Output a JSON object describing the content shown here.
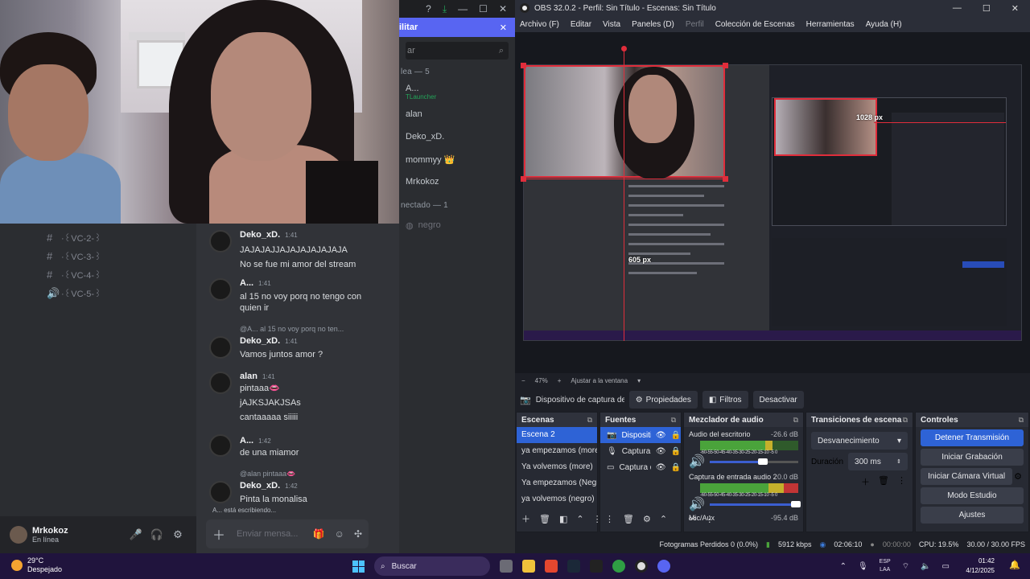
{
  "discord": {
    "banner": {
      "label": "ilitar"
    },
    "member_search": {
      "placeholder": "ar"
    },
    "members": {
      "online_heading": "lea — 5",
      "online": [
        {
          "name": "A...",
          "status": "TLauncher"
        },
        {
          "name": "alan",
          "status": ""
        },
        {
          "name": "Deko_xD.",
          "status": ""
        },
        {
          "name": "mommyy 👑",
          "status": ""
        },
        {
          "name": "Mrkokoz",
          "status": ""
        }
      ],
      "offline_heading": "nectado — 1",
      "offline": [
        {
          "name": "negro"
        }
      ]
    },
    "channels": [
      {
        "icon": "#",
        "name": "·꒰VC-2-꒱"
      },
      {
        "icon": "#",
        "name": "·꒰VC-3-꒱"
      },
      {
        "icon": "#",
        "name": "·꒰VC-4-꒱"
      },
      {
        "icon": "🔊",
        "name": "·꒰VC-5-꒱"
      }
    ],
    "user": {
      "name": "Mrkokoz",
      "status": "En línea"
    },
    "messages": [
      {
        "author": "Deko_xD.",
        "time": "1:41",
        "lines": [
          "JAJAJAJJAJAJAJAJAJAJA",
          "No se fue mi amor del stream"
        ],
        "reply": ""
      },
      {
        "author": "A...",
        "time": "1:41",
        "lines": [
          "al 15 no voy porq no tengo con",
          "quien ir"
        ],
        "reply": ""
      },
      {
        "author": "Deko_xD.",
        "time": "1:41",
        "lines": [
          "Vamos juntos amor ?"
        ],
        "reply": "@A... al 15 no voy porq no ten..."
      },
      {
        "author": "alan",
        "time": "1:41",
        "lines": [
          "pintaaa👄",
          "jAJKSJAKJSAs",
          "cantaaaaa siiiii"
        ],
        "reply": ""
      },
      {
        "author": "A...",
        "time": "1:42",
        "lines": [
          "de una miamor"
        ],
        "reply": ""
      },
      {
        "author": "Deko_xD.",
        "time": "1:42",
        "lines": [
          "Pinta la monalisa"
        ],
        "reply": "@alan pintaaa👄"
      }
    ],
    "typing": "A... está escribiendo...",
    "input_placeholder": "Enviar mensa..."
  },
  "obs": {
    "title": "OBS 32.0.2 - Perfil: Sin Título - Escenas: Sin Título",
    "menu": [
      "Archivo (F)",
      "Editar",
      "Vista",
      "Paneles (D)",
      "Perfil",
      "Colección de Escenas",
      "Herramientas",
      "Ayuda (H)"
    ],
    "menu_disabled": "Perfil",
    "preview": {
      "label_width": "1028 px",
      "label_height": "605 px"
    },
    "zoom": {
      "value": "47%",
      "fit": "Ajustar a la ventana"
    },
    "source_bar": {
      "source": "Dispositivo de captura de vídeo",
      "properties": "Propiedades",
      "filters": "Filtros",
      "deactivate": "Desactivar"
    },
    "scenes": {
      "title": "Escenas",
      "items": [
        "Escena 2",
        "ya empezamos (more)",
        "Ya volvemos (more)",
        "Ya empezamos (Negro)",
        "ya volvemos (negro)"
      ],
      "selected": 0
    },
    "sources": {
      "title": "Fuentes",
      "items": [
        {
          "name": "Dispositivo",
          "icon": "camera-icon"
        },
        {
          "name": "Captura de",
          "icon": "mic-icon"
        },
        {
          "name": "Captura d",
          "icon": "monitor-icon"
        }
      ]
    },
    "mixer": {
      "title": "Mezclador de audio",
      "channels": [
        {
          "name": "Audio del escritorio",
          "db": "-26.6 dB",
          "level": 0.74
        },
        {
          "name": "Captura de entrada audio 2",
          "db": "0.0 dB",
          "level": 1.0
        },
        {
          "name": "Mic/Aux",
          "db": "-95.4 dB",
          "level": 0.0
        }
      ],
      "ticks": "-60-55-50-45-40-35-30-25-20-15-10 -5  0"
    },
    "transitions": {
      "title": "Transiciones de escena",
      "selected": "Desvanecimiento",
      "duration_label": "Duración",
      "duration_value": "300 ms"
    },
    "controls": {
      "title": "Controles",
      "stop_stream": "Detener Transmisión",
      "start_rec": "Iniciar Grabación",
      "virtual_cam": "Iniciar Cámara Virtual",
      "studio": "Modo Estudio",
      "settings": "Ajustes"
    },
    "status": {
      "dropped": "Fotogramas Perdidos 0 (0.0%)",
      "bitrate": "5912 kbps",
      "stream_time": "02:06:10",
      "rec_time": "00:00:00",
      "cpu": "CPU: 19.5%",
      "fps": "30.00 / 30.00 FPS"
    }
  },
  "taskbar": {
    "weather": {
      "temp": "29°C",
      "desc": "Despejado"
    },
    "search": "Buscar",
    "lang": {
      "line1": "ESP",
      "line2": "LAA"
    },
    "clock": {
      "time": "01:42",
      "date": "4/12/2025"
    },
    "colors": {
      "accent": "#5865f2",
      "obs_select": "#2e63d6",
      "red_guide": "#e02d3b"
    }
  }
}
